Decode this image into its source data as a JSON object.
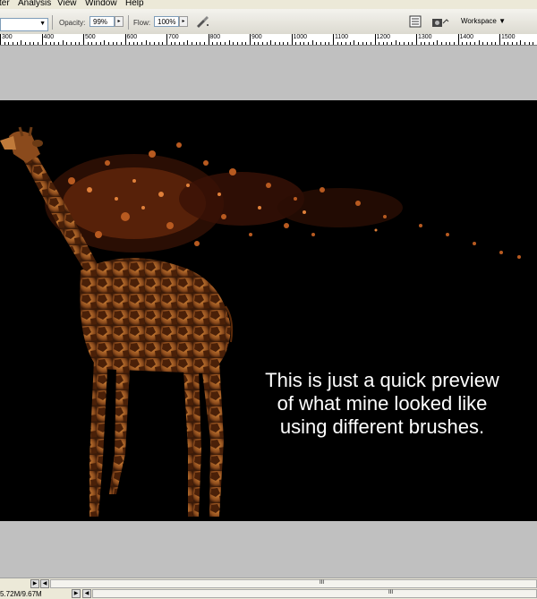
{
  "menu": {
    "items": [
      "ter",
      "Analysis",
      "View",
      "Window",
      "Help"
    ]
  },
  "options": {
    "opacity_label": "Opacity:",
    "opacity_value": "99%",
    "flow_label": "Flow:",
    "flow_value": "100%",
    "workspace_label": "Workspace ▼"
  },
  "ruler": {
    "labels": [
      "300",
      "400",
      "500",
      "600",
      "700",
      "800",
      "900",
      "1000",
      "1100",
      "1200",
      "1300",
      "1400",
      "1500"
    ]
  },
  "caption": {
    "line1": "This is just a quick preview",
    "line2": "of what mine looked like",
    "line3": "using different brushes."
  },
  "status": {
    "doc_size": "5.72M/9.67M",
    "scroll_grip": "III"
  },
  "colors": {
    "ui_bg": "#ece9d8",
    "pasteboard": "#c0c0c0",
    "canvas_bg": "#000000",
    "caption": "#ffffff"
  }
}
